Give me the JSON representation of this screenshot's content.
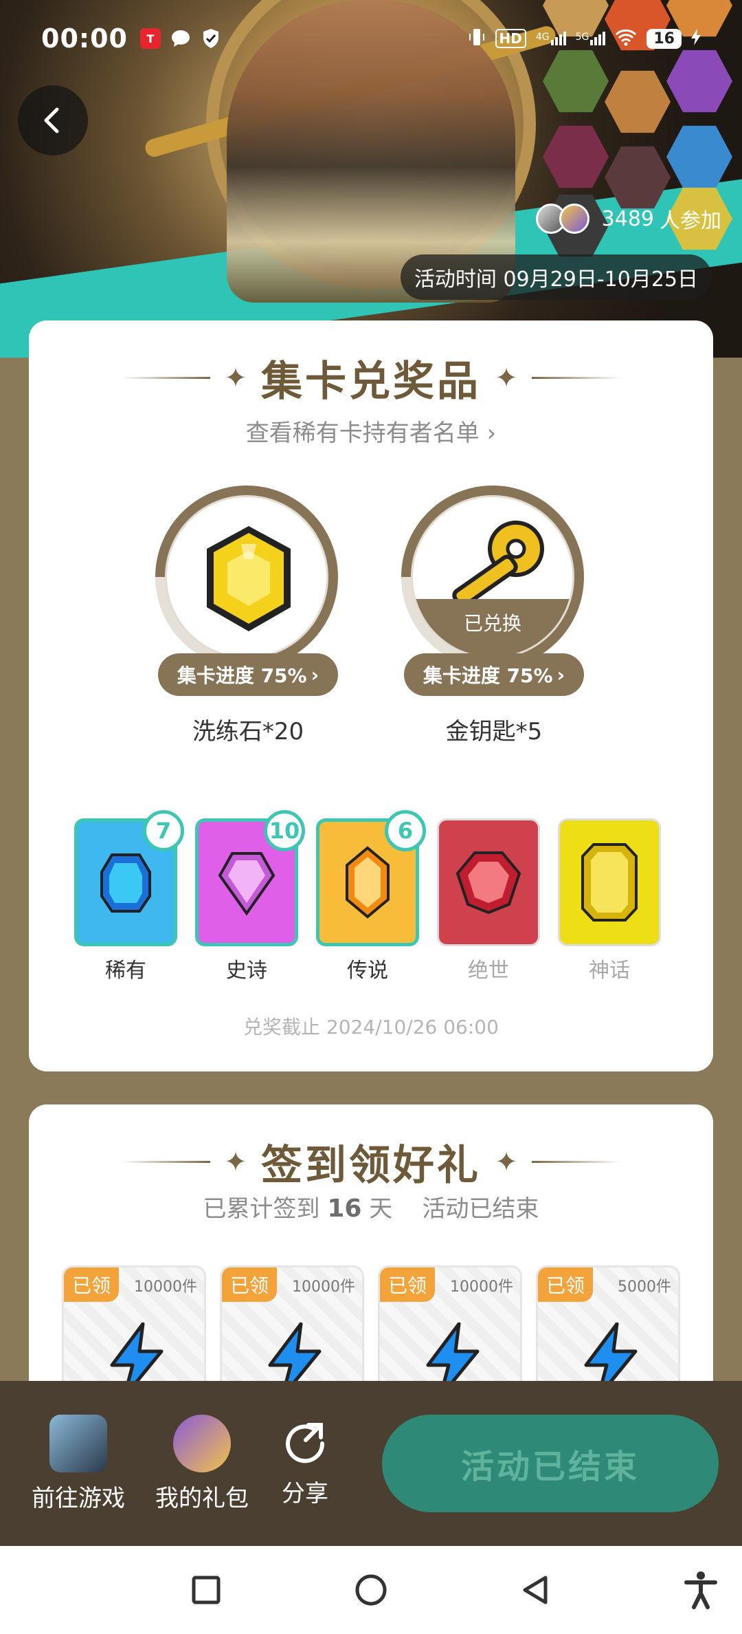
{
  "status_bar": {
    "time": "00:00",
    "network_hd": "HD",
    "network_4g": "4G",
    "network_5g": "5G",
    "battery": "16"
  },
  "hero": {
    "participants_count": "3489",
    "participants_suffix": "人参加",
    "period": "活动时间 09月29日-10月25日"
  },
  "collect": {
    "title": "集卡兑奖品",
    "subtitle": "查看稀有卡持有者名单",
    "prizes": [
      {
        "name": "洗练石*20",
        "progress_label": "集卡进度 75%",
        "progress": 0.75,
        "redeemed": false
      },
      {
        "name": "金钥匙*5",
        "progress_label": "集卡进度 75%",
        "progress": 0.75,
        "redeemed": true,
        "redeemed_label": "已兑换"
      }
    ],
    "rarities": [
      {
        "label": "稀有",
        "count": "7",
        "color": "#3fb8ef",
        "active": true
      },
      {
        "label": "史诗",
        "count": "10",
        "color": "#e05fe8",
        "active": true
      },
      {
        "label": "传说",
        "count": "6",
        "color": "#f7bd3a",
        "active": true
      },
      {
        "label": "绝世",
        "count": "",
        "color": "#d0414e",
        "active": false
      },
      {
        "label": "神话",
        "count": "",
        "color": "#eede16",
        "active": false
      }
    ],
    "deadline": "兑奖截止 2024/10/26 06:00"
  },
  "signin": {
    "title": "签到领好礼",
    "info_prefix": "已累计签到",
    "days": "16",
    "info_suffix": "天",
    "status": "活动已结束",
    "gifts": [
      {
        "tag": "已领",
        "qty": "10000件"
      },
      {
        "tag": "已领",
        "qty": "10000件"
      },
      {
        "tag": "已领",
        "qty": "10000件"
      },
      {
        "tag": "已领",
        "qty": "5000件"
      }
    ]
  },
  "bottom_bar": {
    "go_game": "前往游戏",
    "my_gifts": "我的礼包",
    "share": "分享",
    "end_button": "活动已结束"
  },
  "colors": {
    "accent_brown": "#877355",
    "teal": "#3cc6b3",
    "end_button": "#2e8a76",
    "tag_orange": "#f3a33a"
  }
}
